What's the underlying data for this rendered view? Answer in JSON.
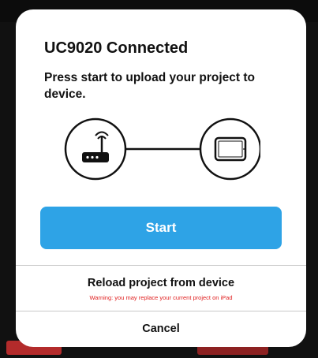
{
  "dialog": {
    "title": "UC9020 Connected",
    "message": "Press start to upload your project to device.",
    "diagram": {
      "left_icon": "router-icon",
      "right_icon": "tablet-icon"
    },
    "start_label": "Start",
    "reload_label": "Reload project from device",
    "reload_warning": "Warning: you may replace your current project on iPad",
    "cancel_label": "Cancel"
  },
  "colors": {
    "accent": "#2ea3e6",
    "warning": "#e02020",
    "text": "#111111",
    "divider": "#c8c8c8"
  }
}
